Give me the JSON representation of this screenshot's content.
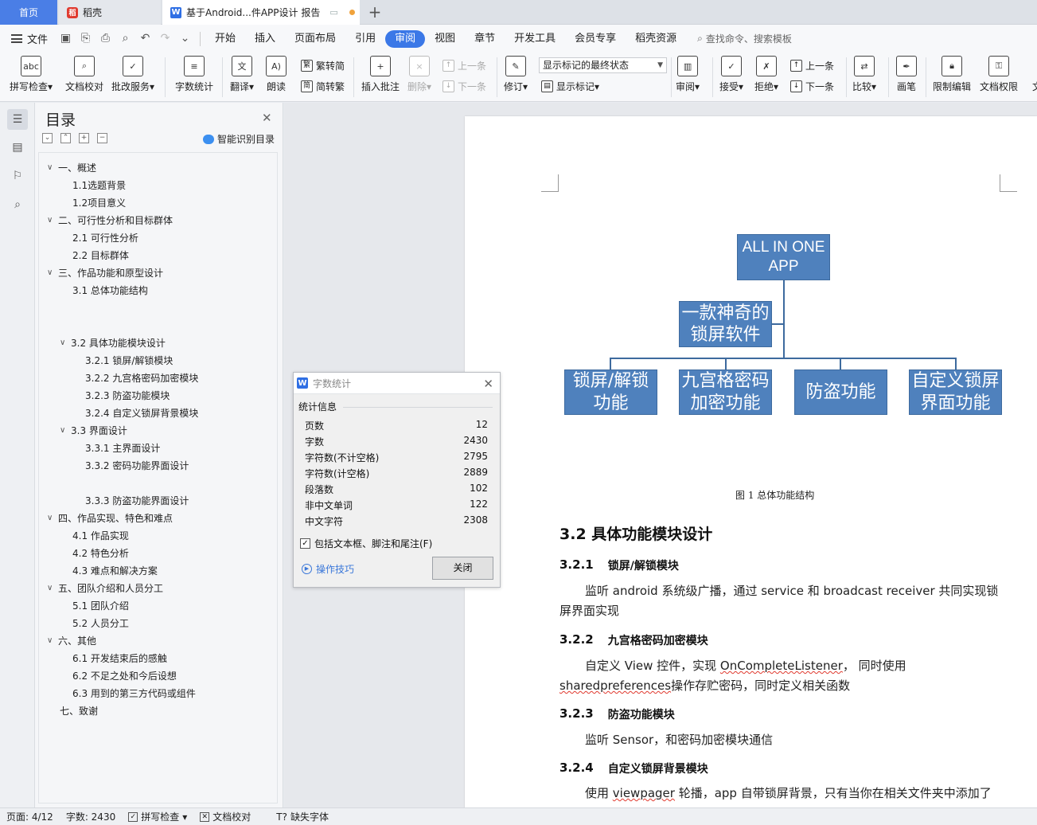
{
  "tabs": {
    "home": "首页",
    "daoke": "稻壳",
    "doc": "基于Android...件APP设计 报告"
  },
  "menu": {
    "file": "文件",
    "items": [
      "开始",
      "插入",
      "页面布局",
      "引用",
      "审阅",
      "视图",
      "章节",
      "开发工具",
      "会员专享",
      "稻壳资源"
    ],
    "active": "审阅",
    "search": "查找命令、搜索模板"
  },
  "ribbon": {
    "spell": "拼写检查",
    "proof": "文档校对",
    "batch": "批改服务",
    "wordcount": "字数统计",
    "translate": "翻译",
    "read": "朗读",
    "t2s": "繁转简",
    "s2t": "简转繁",
    "insert_comment": "插入批注",
    "delete": "删除",
    "prev": "上一条",
    "next": "下一条",
    "revise": "修订",
    "state": "显示标记的最终状态",
    "show_marks": "显示标记",
    "review": "审阅",
    "accept": "接受",
    "reject": "拒绝",
    "prev2": "上一条",
    "next2": "下一条",
    "compare": "比较",
    "pen": "画笔",
    "restrict": "限制编辑",
    "permission": "文档权限",
    "more": "文"
  },
  "toc": {
    "title": "目录",
    "smart": "智能识别目录",
    "items": [
      "一、概述",
      "1.1选题背景",
      "1.2项目意义",
      "二、可行性分析和目标群体",
      "2.1 可行性分析",
      "2.2 目标群体",
      "三、作品功能和原型设计",
      "3.1 总体功能结构",
      "3.2 具体功能模块设计",
      "3.2.1 锁屏/解锁模块",
      "3.2.2 九宫格密码加密模块",
      "3.2.3 防盗功能模块",
      "3.2.4 自定义锁屏背景模块",
      "3.3 界面设计",
      "3.3.1 主界面设计",
      "3.3.2 密码功能界面设计",
      "3.3.3 防盗功能界面设计",
      "四、作品实现、特色和难点",
      "4.1 作品实现",
      "4.2 特色分析",
      "4.3 难点和解决方案",
      "五、团队介绍和人员分工",
      "5.1 团队介绍",
      "5.2 人员分工",
      "六、其他",
      "6.1 开发结束后的感触",
      "6.2 不足之处和今后设想",
      "6.3 用到的第三方代码或组件",
      "七、致谢"
    ]
  },
  "dialog": {
    "title": "字数统计",
    "section": "统计信息",
    "rows": [
      {
        "label": "页数",
        "value": "12"
      },
      {
        "label": "字数",
        "value": "2430"
      },
      {
        "label": "字符数(不计空格)",
        "value": "2795"
      },
      {
        "label": "字符数(计空格)",
        "value": "2889"
      },
      {
        "label": "段落数",
        "value": "102"
      },
      {
        "label": "非中文单词",
        "value": "122"
      },
      {
        "label": "中文字符",
        "value": "2308"
      }
    ],
    "checkbox": "包括文本框、脚注和尾注(F)",
    "tips": "操作技巧",
    "close": "关闭"
  },
  "doc": {
    "org": {
      "root": "ALL IN ONE APP",
      "note": "一款神奇的锁屏软件",
      "children": [
        "锁屏/解锁功能",
        "九宫格密码加密功能",
        "防盗功能",
        "自定义锁屏界面功能"
      ]
    },
    "caption": "图 1 总体功能结构",
    "h2": "3.2 具体功能模块设计",
    "s1_num": "3.2.1",
    "s1_title": "锁屏/解锁模块",
    "p1": "监听 android 系统级广播，通过 service 和 broadcast receiver 共同实现锁屏界面实现",
    "s2_num": "3.2.2",
    "s2_title": "九宫格密码加密模块",
    "p2_a": "自定义 View 控件，实现 ",
    "p2_b": "OnCompleteListener",
    "p2_c": "， 同时使用 ",
    "p2_d": "sharedpreferences",
    "p2_e": "操作存贮密码，同时定义相关函数",
    "s3_num": "3.2.3",
    "s3_title": "防盗功能模块",
    "p3": "监听 Sensor，和密码加密模块通信",
    "s4_num": "3.2.4",
    "s4_title": "自定义锁屏背景模块",
    "p4_a": "使用 ",
    "p4_b": "viewpager",
    "p4_c": " 轮播，app 自带锁屏背景，只有当你在相关文件夹中添加了"
  },
  "status": {
    "page": "页面: 4/12",
    "words": "字数: 2430",
    "spell": "拼写检查",
    "proof": "文档校对",
    "font": "缺失字体"
  },
  "colors": {
    "accent": "#3b78e7",
    "org_fill": "#4f81bd",
    "tab_home": "#4a7ee6"
  }
}
